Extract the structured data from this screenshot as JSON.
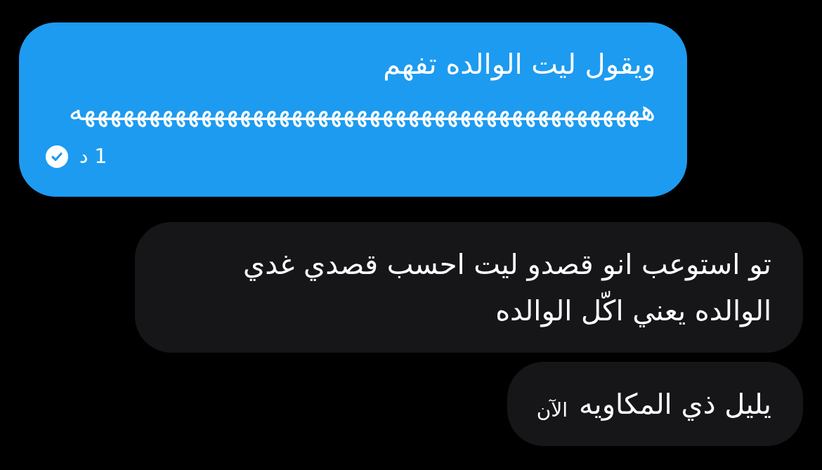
{
  "messages": [
    {
      "kind": "sent",
      "text": "ويقول ليت الوالده تفهم ههههههههههههههههههههههههههههههههههههههههههههه",
      "time": "1 د",
      "read": true
    },
    {
      "kind": "received",
      "text": "تو استوعب انو قصدو ليت احسب قصدي غدي الوالده يعني اكّل الوالده"
    },
    {
      "kind": "received",
      "text": "يليل ذي المكاويه",
      "time": "الآن"
    }
  ]
}
